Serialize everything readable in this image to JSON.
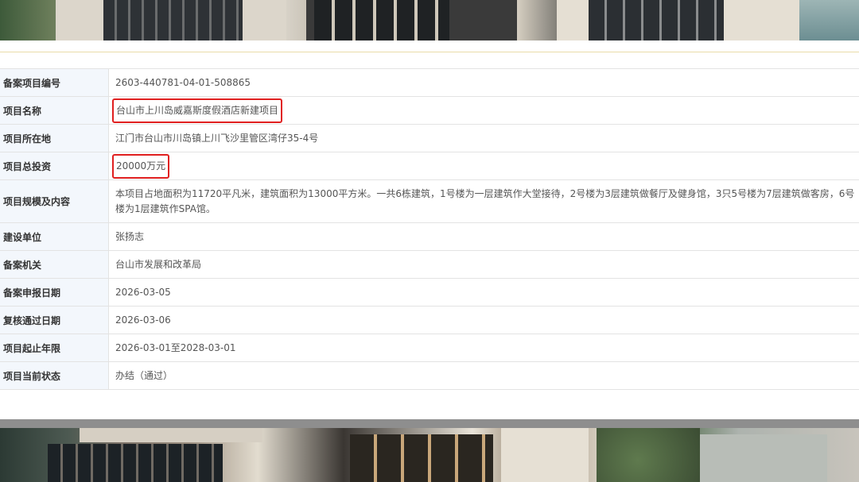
{
  "images": {
    "top_photo": "building-photo",
    "bottom_photo": "building-photo"
  },
  "highlight_color": "#e02020",
  "rows": [
    {
      "label": "备案项目编号",
      "value": "2603-440781-04-01-508865",
      "highlighted": false
    },
    {
      "label": "项目名称",
      "value": "台山市上川岛威嘉斯度假酒店新建项目",
      "highlighted": true
    },
    {
      "label": "项目所在地",
      "value": "江门市台山市川岛镇上川飞沙里管区湾仔35-4号",
      "highlighted": false
    },
    {
      "label": "项目总投资",
      "value": "20000万元",
      "highlighted": true
    },
    {
      "label": "项目规模及内容",
      "value": "本项目占地面积为11720平凡米，建筑面积为13000平方米。一共6栋建筑，1号楼为一层建筑作大堂接待，2号楼为3层建筑做餐厅及健身馆，3只5号楼为7层建筑做客房，6号楼为1层建筑作SPA馆。",
      "highlighted": false
    },
    {
      "label": "建设单位",
      "value": "张扬志",
      "highlighted": false
    },
    {
      "label": "备案机关",
      "value": "台山市发展和改革局",
      "highlighted": false
    },
    {
      "label": "备案申报日期",
      "value": "2026-03-05",
      "highlighted": false
    },
    {
      "label": "复核通过日期",
      "value": "2026-03-06",
      "highlighted": false
    },
    {
      "label": "项目起止年限",
      "value": "2026-03-01至2028-03-01",
      "highlighted": false
    },
    {
      "label": "项目当前状态",
      "value": "办结（通过）",
      "highlighted": false
    }
  ]
}
